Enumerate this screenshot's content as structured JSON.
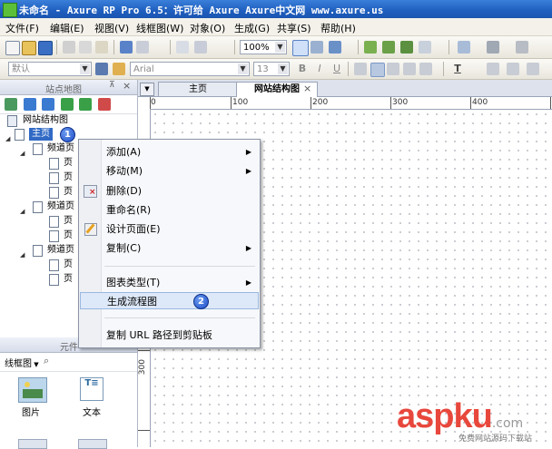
{
  "window": {
    "title": "未命名 - Axure RP Pro 6.5：许可给 Axure Axure中文网 www.axure.us"
  },
  "menubar": [
    "文件(F)",
    "编辑(E)",
    "视图(V)",
    "线框图(W)",
    "对象(O)",
    "生成(G)",
    "共享(S)",
    "帮助(H)"
  ],
  "toolbar": {
    "zoom": "100%",
    "style": "默认",
    "font": "Arial",
    "font_size": "13",
    "bold": "B",
    "italic": "I",
    "underline": "U",
    "text_color": "T"
  },
  "sitemap": {
    "title": "站点地图",
    "items": [
      {
        "label": "网站结构图",
        "level": 0
      },
      {
        "label": "主页",
        "level": 0,
        "selected": true,
        "badge": "1"
      },
      {
        "label": "频道页",
        "level": 1
      },
      {
        "label": "页",
        "level": 2
      },
      {
        "label": "页",
        "level": 2
      },
      {
        "label": "页",
        "level": 2
      },
      {
        "label": "频道页",
        "level": 1
      },
      {
        "label": "页",
        "level": 2
      },
      {
        "label": "页",
        "level": 2
      },
      {
        "label": "频道页",
        "level": 1
      },
      {
        "label": "页",
        "level": 2
      },
      {
        "label": "页",
        "level": 2
      }
    ]
  },
  "widgets": {
    "title": "元件",
    "library": "线框图",
    "items": [
      {
        "label": "图片",
        "icon": "image-icon"
      },
      {
        "label": "文本",
        "icon": "text-icon"
      }
    ]
  },
  "tabs": [
    {
      "label": "主页",
      "active": false
    },
    {
      "label": "网站结构图",
      "active": true
    }
  ],
  "ruler": {
    "h_labels": [
      "0",
      "100",
      "200",
      "300",
      "400"
    ],
    "v_labels": [
      "300"
    ]
  },
  "context_menu": {
    "items": [
      {
        "label": "添加(A)",
        "submenu": true
      },
      {
        "label": "移动(M)",
        "submenu": true
      },
      {
        "label": "删除(D)",
        "submenu": false
      },
      {
        "label": "重命名(R)",
        "submenu": false
      },
      {
        "label": "设计页面(E)",
        "submenu": false
      },
      {
        "label": "复制(C)",
        "submenu": true
      },
      {
        "label": "图表类型(T)",
        "submenu": true
      },
      {
        "label": "生成流程图",
        "submenu": false,
        "highlighted": true,
        "badge": "2"
      },
      {
        "label": "复制 URL 路径到剪贴板",
        "submenu": false
      }
    ]
  },
  "watermark": {
    "brand": "aspku",
    "suffix": ".com",
    "caption": "免费网站源码下载站"
  },
  "colors": {
    "selection": "#316ac5",
    "highlight": "#dde8f8",
    "badge": "#1f4fc8",
    "watermark": "#e8473c"
  }
}
